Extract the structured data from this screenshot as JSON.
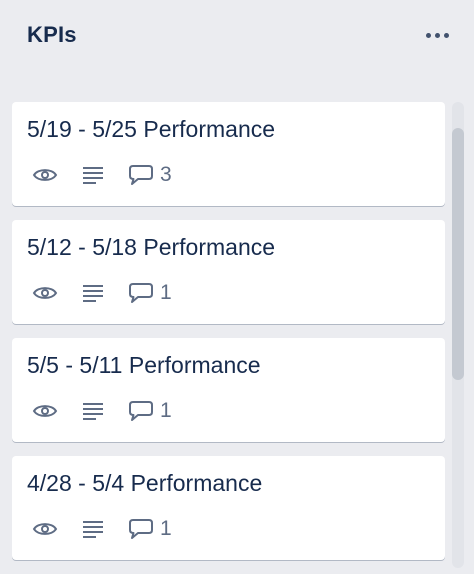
{
  "list": {
    "title": "KPIs",
    "menu_icon": "more-horizontal-icon"
  },
  "cards": [
    {
      "title": "5/19 - 5/25 Performance",
      "comments": "3"
    },
    {
      "title": "5/12 - 5/18 Performance",
      "comments": "1"
    },
    {
      "title": "5/5 - 5/11 Performance",
      "comments": "1"
    },
    {
      "title": "4/28 - 5/4 Performance",
      "comments": "1"
    }
  ],
  "badge_icons": [
    "eye-icon",
    "description-icon",
    "comment-icon"
  ],
  "colors": {
    "list_background": "#ebecf0",
    "card_background": "#ffffff",
    "title_text": "#172b4d",
    "icon": "#5e6c84"
  }
}
